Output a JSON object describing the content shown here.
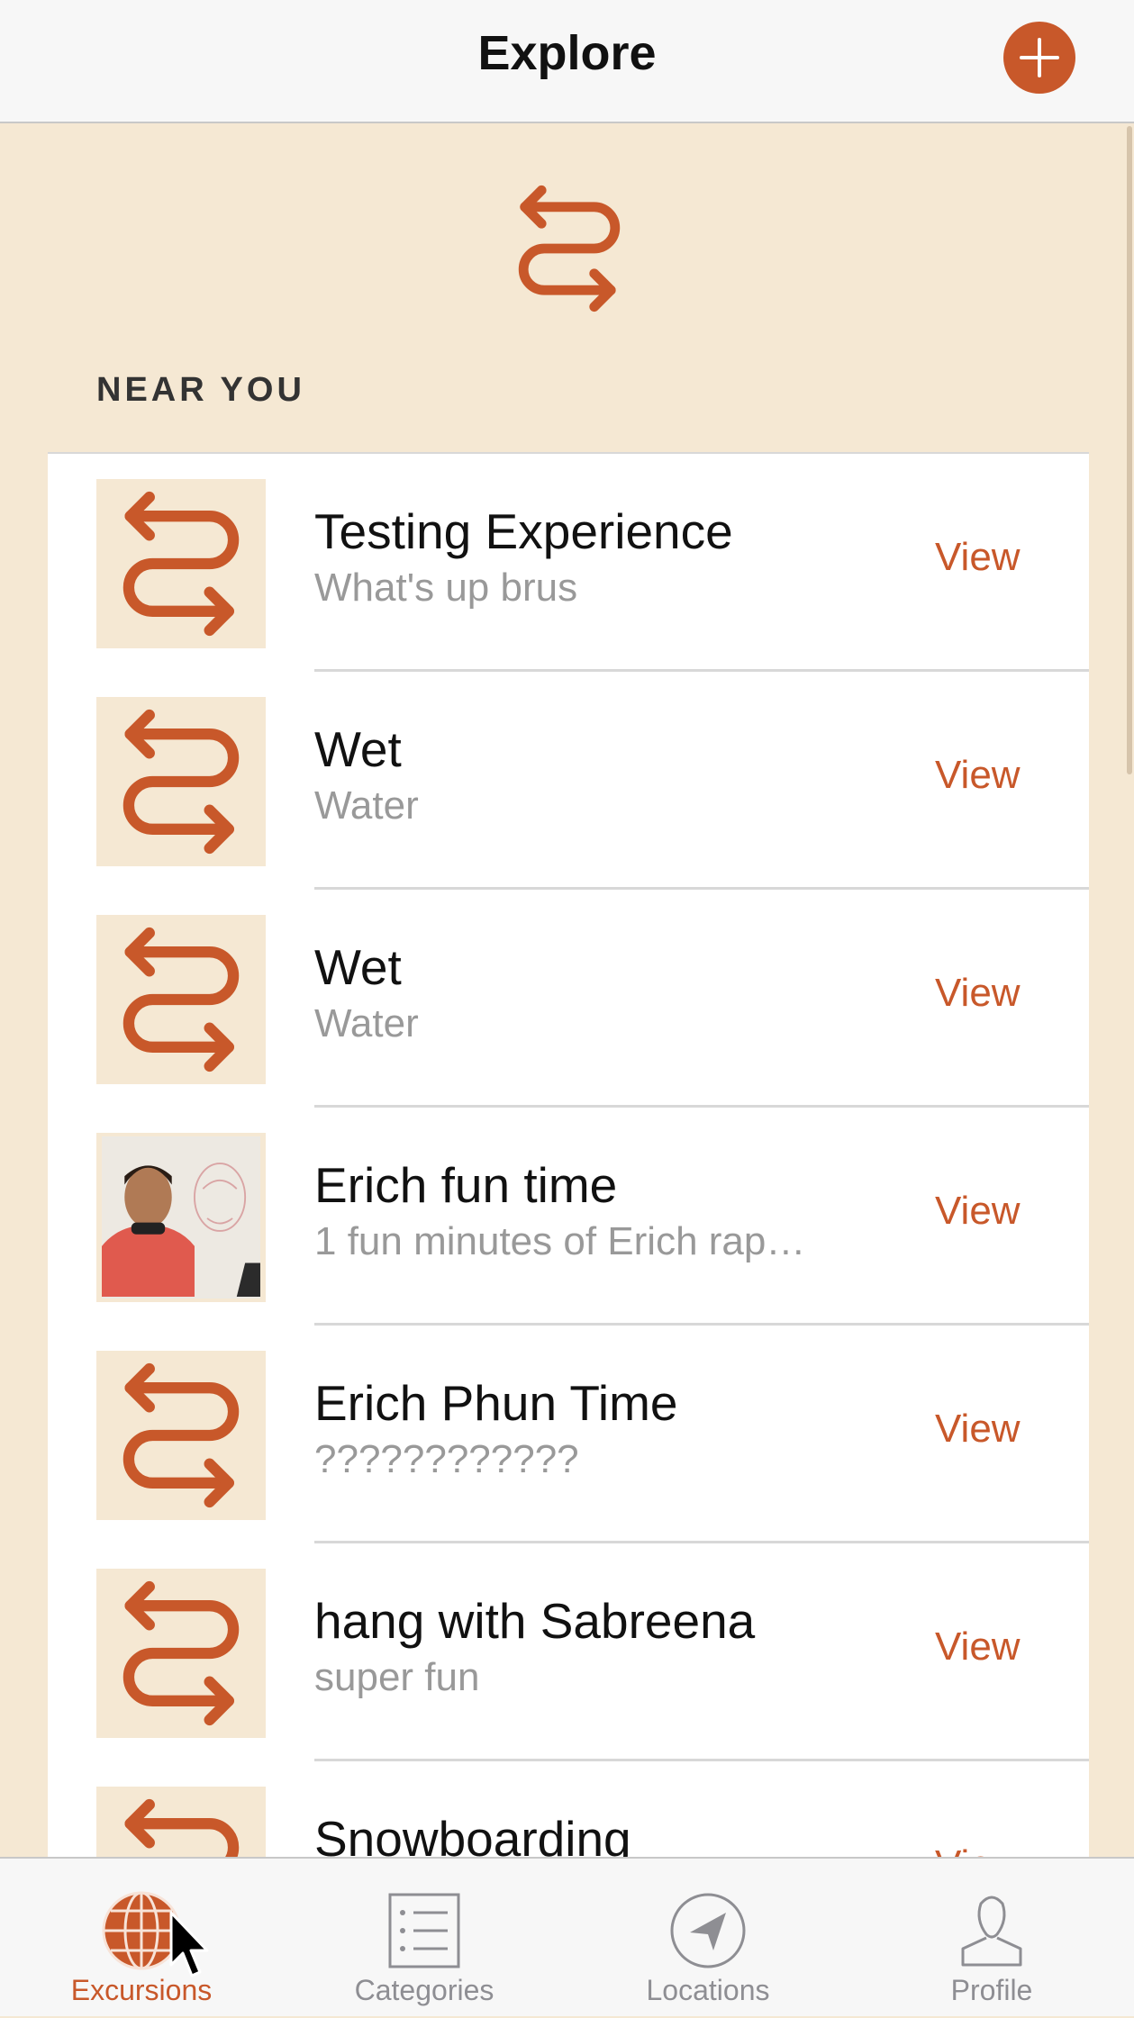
{
  "header": {
    "title": "Explore",
    "add_icon": "plus-circle-icon"
  },
  "accent_color": "#c8582a",
  "hero": {
    "icon": "excursion-route-icon"
  },
  "section": {
    "label": "NEAR YOU"
  },
  "items": [
    {
      "title": "Testing Experience",
      "subtitle": "What's up brus",
      "action": "View",
      "thumb": "excursion-route-icon"
    },
    {
      "title": "Wet",
      "subtitle": "Water",
      "action": "View",
      "thumb": "excursion-route-icon"
    },
    {
      "title": "Wet",
      "subtitle": "Water",
      "action": "View",
      "thumb": "excursion-route-icon"
    },
    {
      "title": "Erich fun time",
      "subtitle": "1 fun minutes of Erich rap…",
      "action": "View",
      "thumb": "photo"
    },
    {
      "title": "Erich Phun Time",
      "subtitle": "????????????",
      "action": "View",
      "thumb": "excursion-route-icon"
    },
    {
      "title": "hang with Sabreena",
      "subtitle": "super fun",
      "action": "View",
      "thumb": "excursion-route-icon"
    },
    {
      "title": "Snowboarding",
      "subtitle": "",
      "action": "View",
      "thumb": "excursion-route-icon"
    }
  ],
  "tabs": [
    {
      "label": "Excursions",
      "icon": "globe-icon",
      "active": true
    },
    {
      "label": "Categories",
      "icon": "list-icon",
      "active": false
    },
    {
      "label": "Locations",
      "icon": "location-arrow-icon",
      "active": false
    },
    {
      "label": "Profile",
      "icon": "person-icon",
      "active": false
    }
  ]
}
